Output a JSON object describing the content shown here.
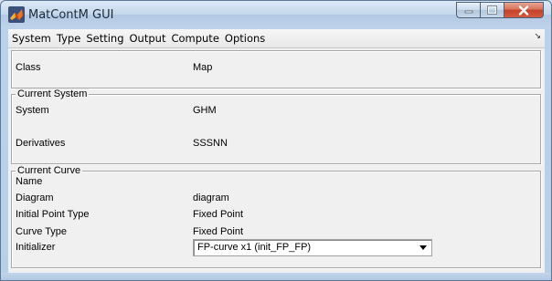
{
  "window": {
    "title": "MatContM GUI",
    "icon": "matlab-icon",
    "controls": {
      "minimize": "minimize-icon",
      "maximize": "maximize-icon",
      "close": "close-icon"
    }
  },
  "menubar": {
    "items": [
      "System",
      "Type",
      "Setting",
      "Output",
      "Compute",
      "Options"
    ],
    "overflow_glyph": "↘"
  },
  "class_panel": {
    "label": "Class",
    "value": "Map"
  },
  "current_system": {
    "legend": "Current System",
    "system_label": "System",
    "system_value": "GHM",
    "derivatives_label": "Derivatives",
    "derivatives_value": "SSSNN"
  },
  "current_curve": {
    "legend": "Current Curve",
    "name_label": "Name",
    "diagram_label": "Diagram",
    "diagram_value": "diagram",
    "initial_point_type_label": "Initial Point Type",
    "initial_point_type_value": "Fixed Point",
    "curve_type_label": "Curve Type",
    "curve_type_value": "Fixed Point",
    "initializer_label": "Initializer",
    "initializer_value": "FP-curve  x1  (init_FP_FP)"
  },
  "colors": {
    "titlebar": "#c4d7ec",
    "close_button": "#c4432a",
    "panel_background": "#f0f0f0"
  }
}
